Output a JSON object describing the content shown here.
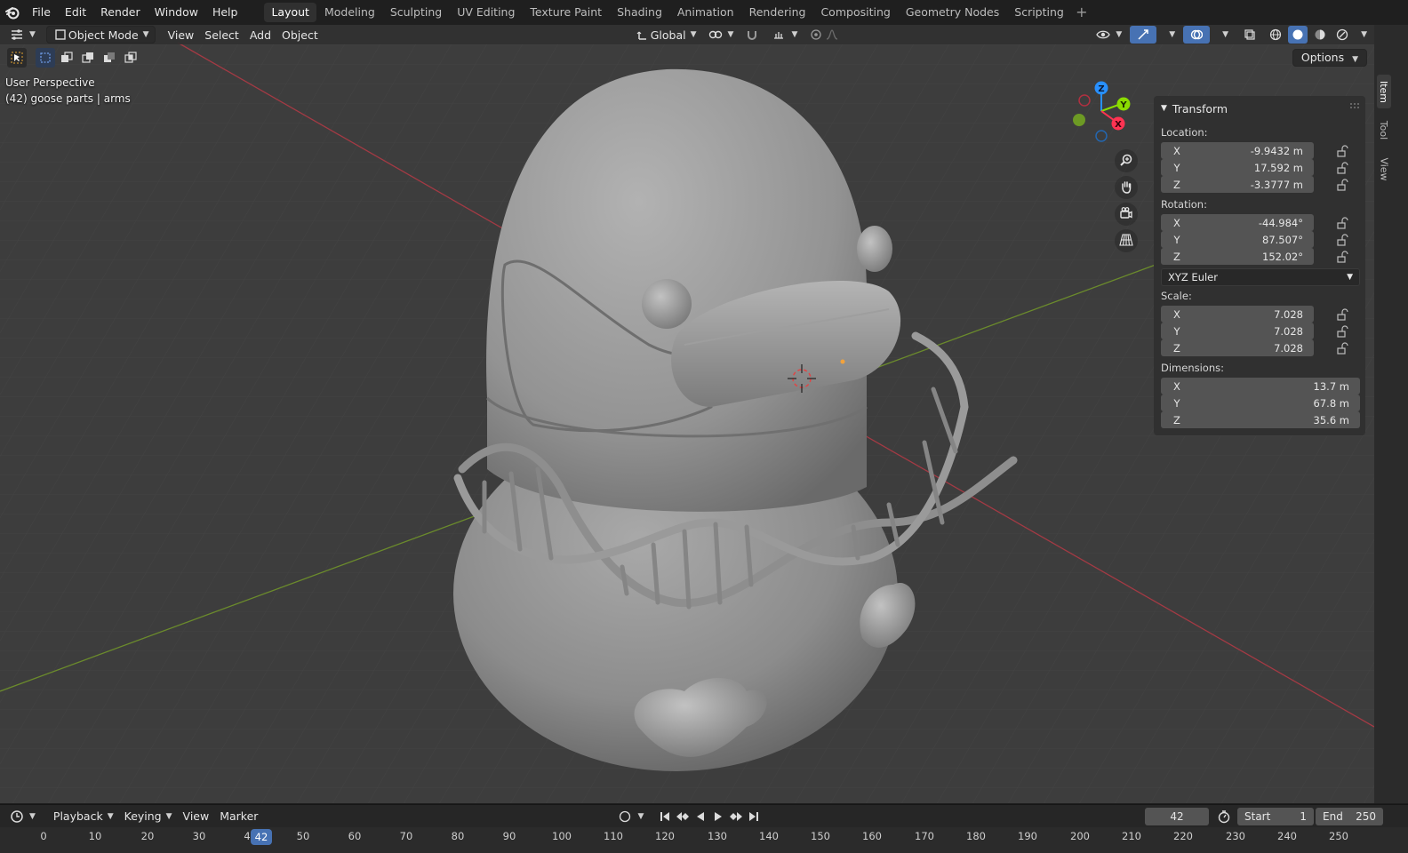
{
  "menu": [
    "File",
    "Edit",
    "Render",
    "Window",
    "Help"
  ],
  "workspaces": [
    "Layout",
    "Modeling",
    "Sculpting",
    "UV Editing",
    "Texture Paint",
    "Shading",
    "Animation",
    "Rendering",
    "Compositing",
    "Geometry Nodes",
    "Scripting"
  ],
  "active_workspace": "Layout",
  "viewport_header": {
    "mode": "Object Mode",
    "menus": [
      "View",
      "Select",
      "Add",
      "Object"
    ],
    "orientation": "Global",
    "options_label": "Options"
  },
  "viewport_info": {
    "view": "User Perspective",
    "object": "(42) goose parts | arms"
  },
  "gizmo_axes": [
    "Z",
    "Y",
    "X"
  ],
  "transform_panel": {
    "title": "Transform",
    "location": {
      "label": "Location:",
      "x": "-9.9432 m",
      "y": "17.592 m",
      "z": "-3.3777 m"
    },
    "rotation": {
      "label": "Rotation:",
      "x": "-44.984°",
      "y": "87.507°",
      "z": "152.02°"
    },
    "rotation_mode": "XYZ Euler",
    "scale": {
      "label": "Scale:",
      "x": "7.028",
      "y": "7.028",
      "z": "7.028"
    },
    "dimensions": {
      "label": "Dimensions:",
      "x": "13.7 m",
      "y": "67.8 m",
      "z": "35.6 m"
    },
    "axis_labels": [
      "X",
      "Y",
      "Z"
    ]
  },
  "side_tabs": [
    "Item",
    "Tool",
    "View"
  ],
  "timeline": {
    "menus": [
      "Playback",
      "Keying",
      "View",
      "Marker"
    ],
    "current_frame": "42",
    "start_label": "Start",
    "start": "1",
    "end_label": "End",
    "end": "250",
    "ruler": [
      "0",
      "10",
      "20",
      "30",
      "4",
      "50",
      "60",
      "70",
      "80",
      "90",
      "100",
      "110",
      "120",
      "130",
      "140",
      "150",
      "160",
      "170",
      "180",
      "190",
      "200",
      "210",
      "220",
      "230",
      "240",
      "250"
    ],
    "playhead_label": "42"
  },
  "colors": {
    "x_axis": "#ff3352",
    "y_axis": "#8bdc00",
    "z_axis": "#2890ff",
    "selection_accent": "#4772b3"
  }
}
